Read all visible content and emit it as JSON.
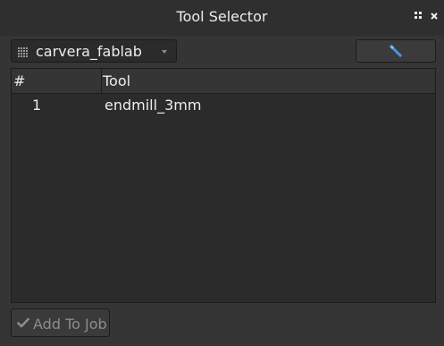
{
  "window": {
    "title": "Tool Selector",
    "float_icon": "float-icon",
    "close_icon": "close-icon"
  },
  "library": {
    "icon": "library-bits-icon",
    "selected": "carvera_fablab",
    "dropdown_icon": "chevron-down-icon"
  },
  "edit_button": {
    "icon": "pencil-icon",
    "accent_color": "#4a90e2"
  },
  "table": {
    "columns": [
      "#",
      "Tool"
    ],
    "rows": [
      {
        "number": "1",
        "tool": "endmill_3mm"
      }
    ]
  },
  "add_button": {
    "icon": "checkmark-icon",
    "label": "Add To Job",
    "enabled": false
  }
}
